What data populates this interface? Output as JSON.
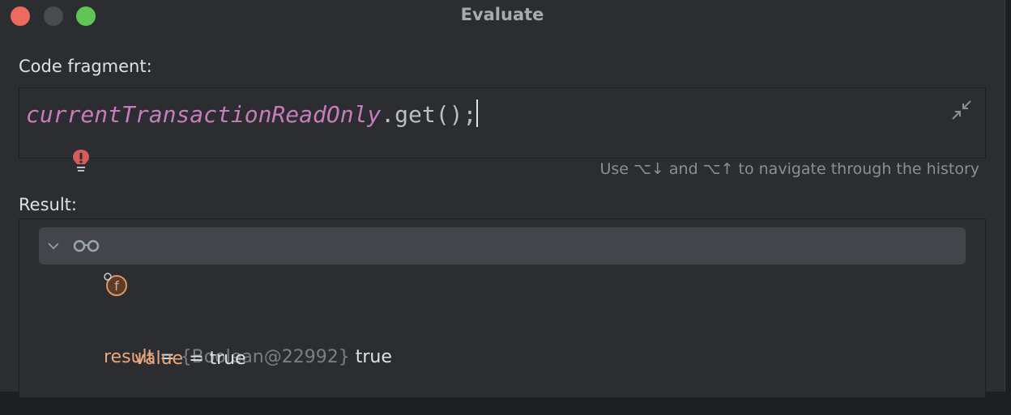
{
  "window": {
    "title": "Evaluate",
    "colors": {
      "close": "#ed6a5e",
      "minimize": "#4a4b4f",
      "zoom": "#61c554"
    }
  },
  "code_fragment": {
    "label": "Code fragment:",
    "field_name": "currentTransactionReadOnly",
    "call": ".get();",
    "history_hint": "Use ⌥↓ and ⌥↑ to navigate through the history"
  },
  "result": {
    "label": "Result:",
    "rows": [
      {
        "name": "result",
        "eq": " = ",
        "type": "{Boolean@22992}",
        "value": " true"
      },
      {
        "name": "value",
        "eq": " = ",
        "value": "true"
      }
    ]
  }
}
